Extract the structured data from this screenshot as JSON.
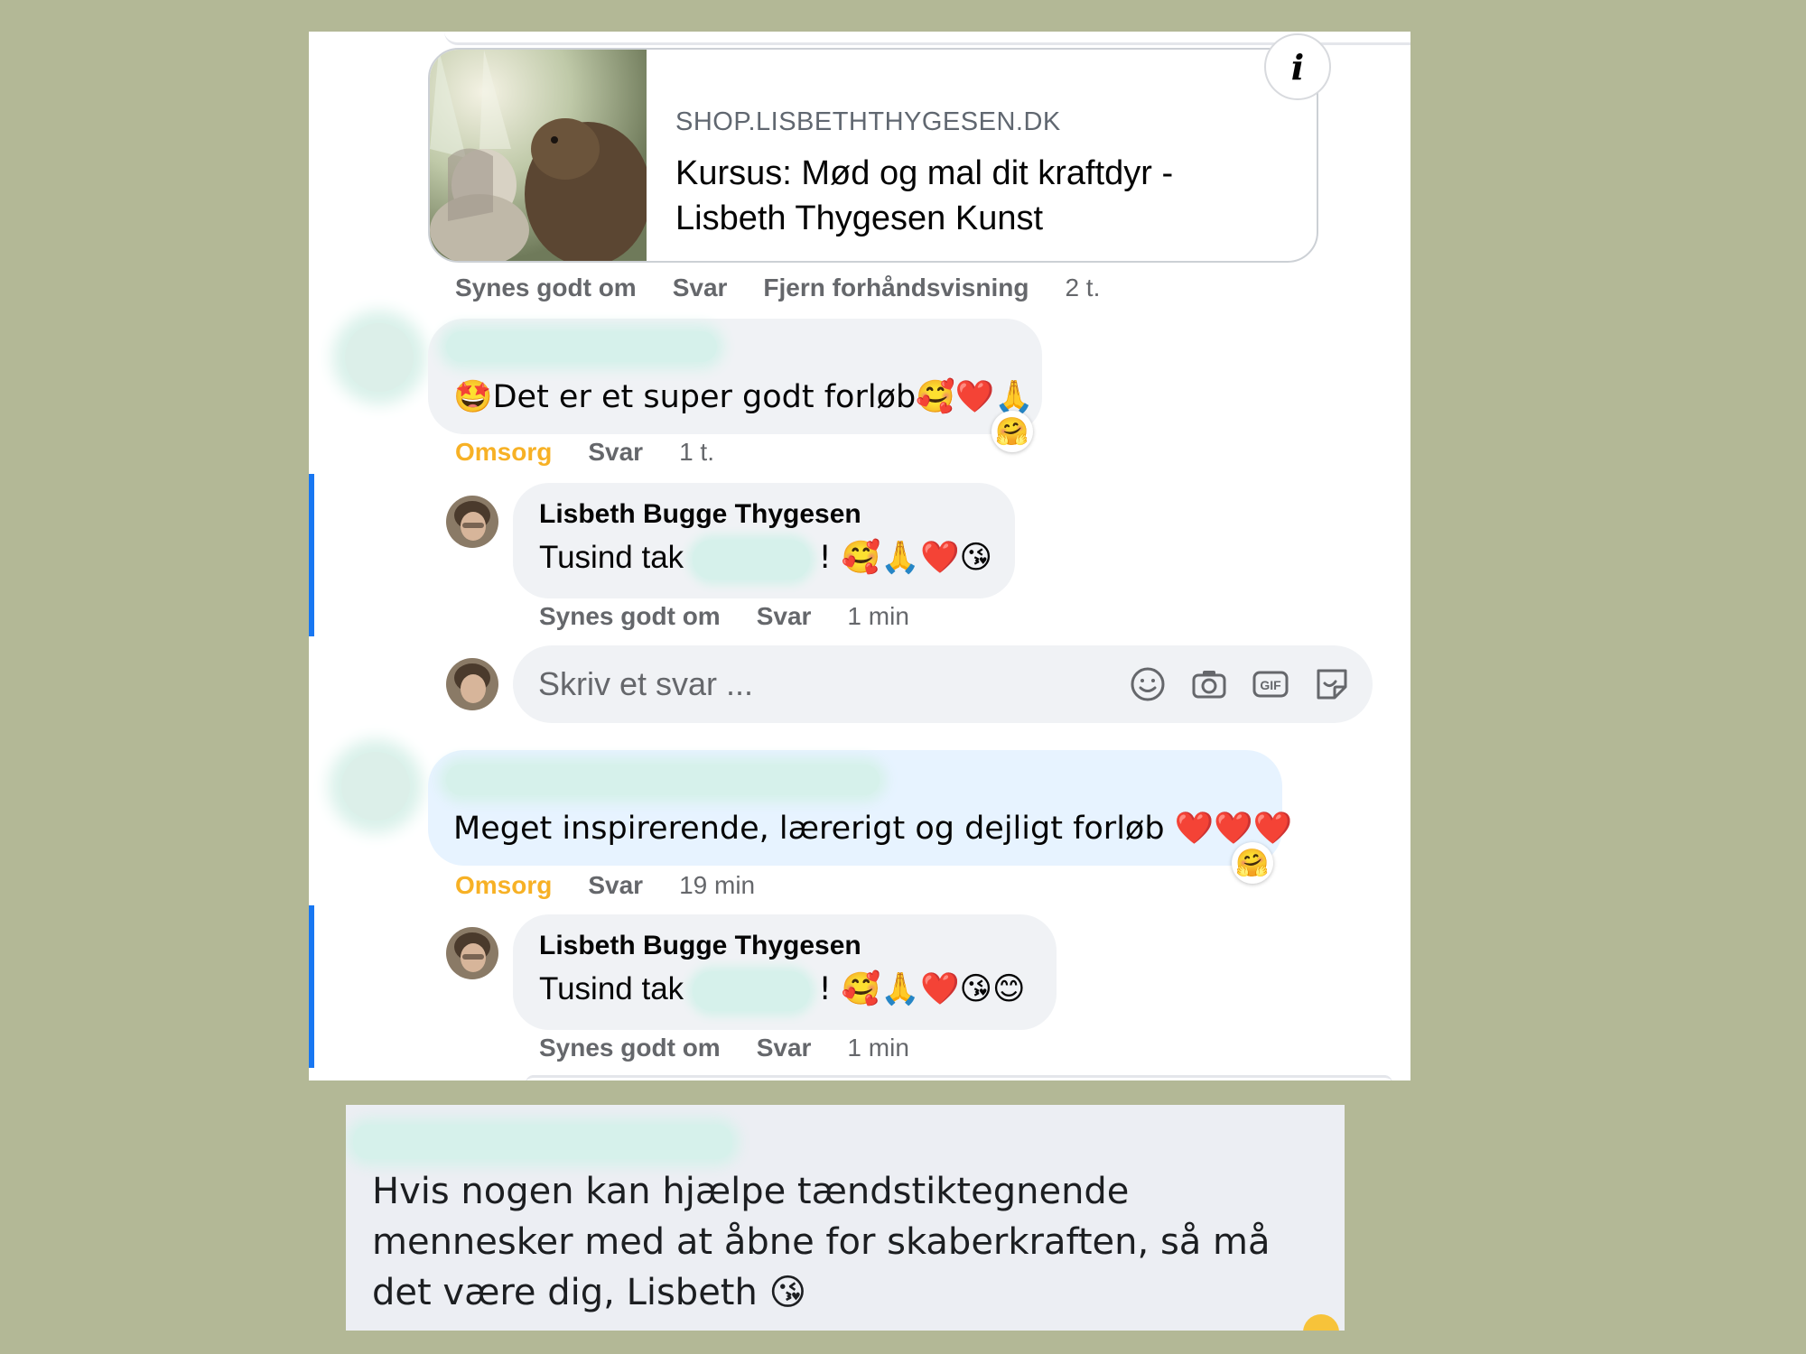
{
  "link_preview": {
    "domain": "SHOP.LISBETHTHYGESEN.DK",
    "title": "Kursus: Mød og mal dit kraftdyr - Lisbeth Thygesen Kunst",
    "info_icon": "i"
  },
  "comment1_actions": {
    "like": "Synes godt om",
    "reply": "Svar",
    "remove_preview": "Fjern forhåndsvisning",
    "time": "2 t."
  },
  "comment2": {
    "text": "🤩Det er et super godt forløb🥰❤️🙏",
    "reaction": "🤗",
    "actions": {
      "reaction_label": "Omsorg",
      "reply": "Svar",
      "time": "1 t."
    }
  },
  "reply1": {
    "author": "Lisbeth Bugge Thygesen",
    "text_before": "Tusind tak",
    "text_after": "! 🥰🙏❤️😘",
    "actions": {
      "like": "Synes godt om",
      "reply": "Svar",
      "time": "1 min"
    }
  },
  "composer": {
    "placeholder": "Skriv et svar ...",
    "icons": [
      "emoji-icon",
      "camera-icon",
      "gif-icon",
      "sticker-icon"
    ],
    "gif_label": "GIF"
  },
  "comment3": {
    "text": "Meget inspirerende, lærerigt og dejligt forløb ❤️❤️❤️",
    "reaction": "🤗",
    "actions": {
      "reaction_label": "Omsorg",
      "reply": "Svar",
      "time": "19 min"
    }
  },
  "reply2": {
    "author": "Lisbeth Bugge Thygesen",
    "text_before": "Tusind tak",
    "text_after": "! 🥰🙏❤️😘😊",
    "actions": {
      "like": "Synes godt om",
      "reply": "Svar",
      "time": "1 min"
    }
  },
  "bottom_comment": {
    "text": "Hvis nogen kan hjælpe tændstiktegnende mennesker med at åbne for skaberkraften, så må det være dig, Lisbeth 😘"
  },
  "colors": {
    "background": "#b3b896",
    "reaction_label": "#f7b125",
    "thread_bar": "#1877f2",
    "bubble": "#f0f2f5",
    "highlight_bubble": "#e7f3ff"
  }
}
